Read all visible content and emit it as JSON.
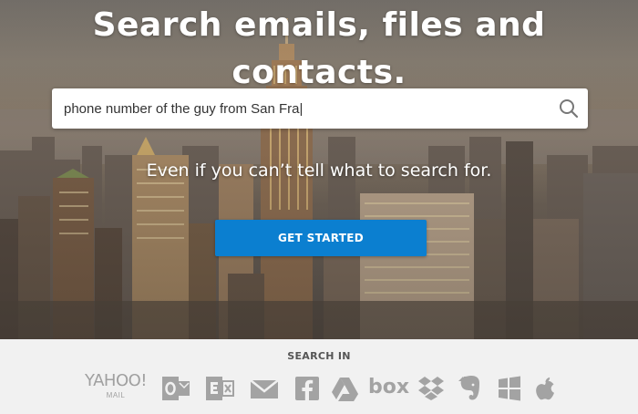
{
  "hero": {
    "headline": "Search emails, files and contacts.",
    "tagline": "Even if you can’t tell what to search for.",
    "cta_label": "GET STARTED"
  },
  "search": {
    "value": "phone number of the guy from San Fra|",
    "icon": "magnifier"
  },
  "footer": {
    "title": "SEARCH IN",
    "services": [
      {
        "name": "yahoo-mail",
        "text": "YAHOO!",
        "subtext": "MAIL"
      },
      {
        "name": "outlook"
      },
      {
        "name": "exchange"
      },
      {
        "name": "gmail"
      },
      {
        "name": "facebook"
      },
      {
        "name": "google-drive"
      },
      {
        "name": "box",
        "text": "box"
      },
      {
        "name": "dropbox"
      },
      {
        "name": "evernote"
      },
      {
        "name": "windows"
      },
      {
        "name": "apple"
      }
    ]
  },
  "colors": {
    "cta": "#0b7fd0",
    "footer_bg": "#f1f1f1",
    "logo_gray": "#a3a3a3"
  }
}
